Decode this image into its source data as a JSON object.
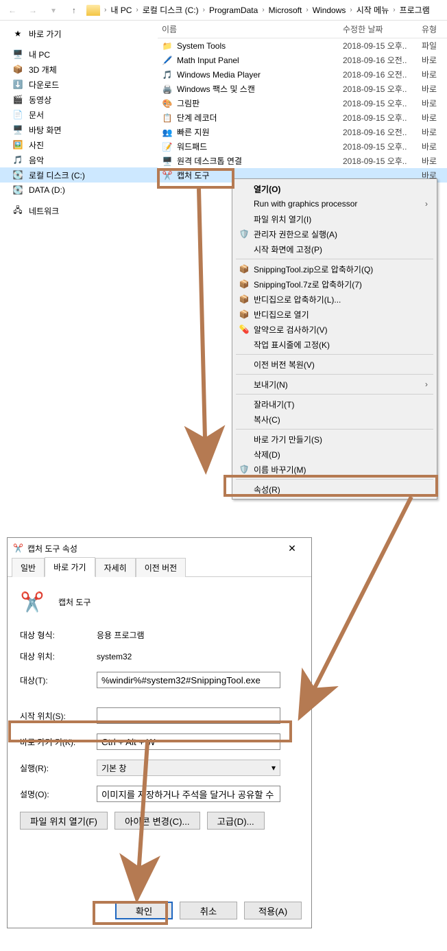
{
  "breadcrumb": [
    "내 PC",
    "로컬 디스크 (C:)",
    "ProgramData",
    "Microsoft",
    "Windows",
    "시작 메뉴",
    "프로그램"
  ],
  "nav": {
    "quick": "바로 가기",
    "pc": "내 PC",
    "obj3d": "3D 개체",
    "downloads": "다운로드",
    "videos": "동영상",
    "docs": "문서",
    "desktop": "바탕 화면",
    "pictures": "사진",
    "music": "음악",
    "cdrive": "로컬 디스크 (C:)",
    "ddrive": "DATA (D:)",
    "network": "네트워크"
  },
  "cols": {
    "name": "이름",
    "date": "수정한 날짜",
    "type": "유형"
  },
  "files": [
    {
      "name": "System Tools",
      "date": "2018-09-15 오후..",
      "type": "파일"
    },
    {
      "name": "Math Input Panel",
      "date": "2018-09-16 오전..",
      "type": "바로"
    },
    {
      "name": "Windows Media Player",
      "date": "2018-09-16 오전..",
      "type": "바로"
    },
    {
      "name": "Windows 팩스 및 스캔",
      "date": "2018-09-15 오후..",
      "type": "바로"
    },
    {
      "name": "그림판",
      "date": "2018-09-15 오후..",
      "type": "바로"
    },
    {
      "name": "단계 레코더",
      "date": "2018-09-15 오후..",
      "type": "바로"
    },
    {
      "name": "빠른 지원",
      "date": "2018-09-16 오전..",
      "type": "바로"
    },
    {
      "name": "워드패드",
      "date": "2018-09-15 오후..",
      "type": "바로"
    },
    {
      "name": "원격 데스크톱 연결",
      "date": "2018-09-15 오후..",
      "type": "바로"
    },
    {
      "name": "캡처 도구",
      "date": "",
      "type": "바로"
    }
  ],
  "ctx": {
    "open": "열기(O)",
    "graphics": "Run with graphics processor",
    "openloc": "파일 위치 열기(I)",
    "admin": "관리자 권한으로 실행(A)",
    "pinstart": "시작 화면에 고정(P)",
    "zip": "SnippingTool.zip으로 압축하기(Q)",
    "sevenz": "SnippingTool.7z로 압축하기(7)",
    "bandizip": "반디집으로 압축하기(L)...",
    "bandiopen": "반디집으로 열기",
    "scan": "알약으로 검사하기(V)",
    "pintaskbar": "작업 표시줄에 고정(K)",
    "restore": "이전 버전 복원(V)",
    "sendto": "보내기(N)",
    "cut": "잘라내기(T)",
    "copy": "복사(C)",
    "shortcut": "바로 가기 만들기(S)",
    "delete": "삭제(D)",
    "rename": "이름 바꾸기(M)",
    "props": "속성(R)"
  },
  "dlg": {
    "title": "캡처 도구 속성",
    "tabs": {
      "general": "일반",
      "shortcut": "바로 가기",
      "detail": "자세히",
      "prev": "이전 버전"
    },
    "appname": "캡처 도구",
    "targettype_l": "대상 형식:",
    "targettype_v": "응용 프로그램",
    "targetloc_l": "대상 위치:",
    "targetloc_v": "system32",
    "target_l": "대상(T):",
    "target_v": "%windir%#system32#SnippingTool.exe",
    "startin_l": "시작 위치(S):",
    "startin_v": "",
    "key_l": "바로 가기 키(K):",
    "key_v": "Ctrl + Alt + W",
    "run_l": "실행(R):",
    "run_v": "기본 창",
    "desc_l": "설명(O):",
    "desc_v": "이미지를 저장하거나 주석을 달거나 공유할 수 있",
    "btn_openloc": "파일 위치 열기(F)",
    "btn_changeico": "아이콘 변경(C)...",
    "btn_adv": "고급(D)...",
    "ok": "확인",
    "cancel": "취소",
    "apply": "적용(A)"
  }
}
